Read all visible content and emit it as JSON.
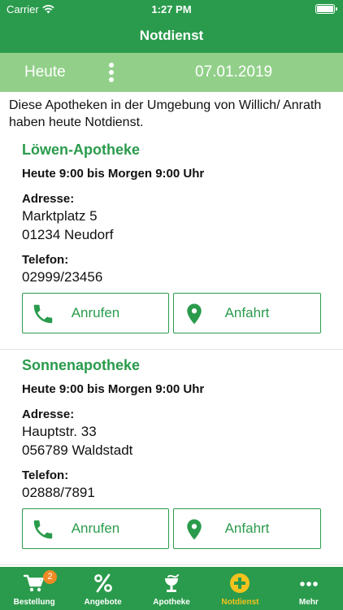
{
  "status": {
    "carrier": "Carrier",
    "time": "1:27 PM"
  },
  "navbar": {
    "title": "Notdienst"
  },
  "datebar": {
    "day": "Heute",
    "date": "07.01.2019"
  },
  "intro": "Diese Apotheken in der Umgebung von Willich/ Anrath haben heute Notdienst.",
  "pharmacies": [
    {
      "name": "Löwen-Apotheke",
      "hours": "Heute 9:00 bis Morgen 9:00 Uhr",
      "address_label": "Adresse:",
      "street": "Marktplatz 5",
      "city": "01234 Neudorf",
      "phone_label": "Telefon:",
      "phone": "02999/23456",
      "call_label": "Anrufen",
      "route_label": "Anfahrt"
    },
    {
      "name": "Sonnenapotheke",
      "hours": "Heute 9:00 bis Morgen 9:00 Uhr",
      "address_label": "Adresse:",
      "street": "Hauptstr. 33",
      "city": "056789 Waldstadt",
      "phone_label": "Telefon:",
      "phone": "02888/7891",
      "call_label": "Anrufen",
      "route_label": "Anfahrt"
    }
  ],
  "tabbar": {
    "badge": "2",
    "items": [
      {
        "label": "Bestellung",
        "icon": "cart-icon"
      },
      {
        "label": "Angebote",
        "icon": "percent-icon"
      },
      {
        "label": "Apotheke",
        "icon": "pharmacy-icon"
      },
      {
        "label": "Notdienst",
        "icon": "plus-circle-icon"
      },
      {
        "label": "Mehr",
        "icon": "more-icon"
      }
    ]
  },
  "colors": {
    "primary": "#2a9b4c",
    "datebar": "#92d08a",
    "active_tab": "#f4c21e",
    "badge": "#f08a24"
  }
}
